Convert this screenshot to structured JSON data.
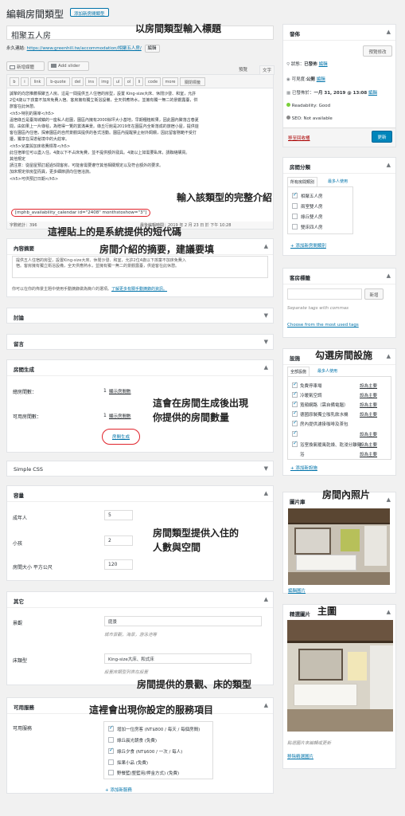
{
  "page_title": "編輯房間類型",
  "add_new_label": "添加新房間類型",
  "post_title": "相聚五人房",
  "permalink": {
    "label": "永久連結:",
    "url": "https://www.greenhill.tw/accommodation/相聚五人房/",
    "edit": "編輯"
  },
  "editor": {
    "add_media": "新增媒體",
    "add_slider": "Add slider",
    "tab_visual": "預覽",
    "tab_text": "文字",
    "quicktags": [
      "b",
      "i",
      "link",
      "b-quote",
      "del",
      "ins",
      "img",
      "ul",
      "ol",
      "li",
      "code",
      "more",
      "關閉標籤"
    ],
    "content_lines": [
      "誠摯的向您推薦相聚五人房。這是一間提供五人住宿的房型，設置 King-size大床、休閒沙發、和室，允許",
      "2位4歲以下孩童不加床免費入宿。客房擁有獨立衛浴設備，全天供應熱水，並擁有獨一無二的景觀露臺，供",
      "旅客在此休憩。",
      "<h5>特別的陽宰</h5>",
      "溫宿綠丘是臺灣城鎮的一座私人莊園，園區內擁有2000餘坪大小基地，早期種植較果，因此園內聚落古春夏",
      "間，由如果上一片綠毯，為贈得一覽的賞滿美景。綠丘行館是2019年在園區內全新落成的旅宿小屋，提供遊",
      "客在園區內住宿，探索園區的自然景觀與提供的各式活動。園區內提醒禁止射外飼餵，因此留客務範不受打",
      "擾，獨享在深遂秘境中的大莊宰。",
      "<h5>兒童與加床收費標準</h5>",
      "此住宿單位可以盡入住。4歲以下不占床免費，並不提供額外寢具。4歲以上如需要臥床，請聯絡購買。",
      "其他規定",
      "請注意：從屋屋預訂超過5間客房，可能會需要遵守其他相關規定以及符合額外的要求。",
      "加床規定依房型而異，更多細節請向住宿洽詢。",
      "<h5>可供預訂日期</h5>"
    ],
    "shortcode": "[mphb_availability_calendar id=\"2408\" monthstoshow=\"3\"]",
    "word_count": "字數統計：396",
    "last_edit": "最後編輯時間：2019 年 2 月 23 日 於 下午 10:28"
  },
  "excerpt": {
    "title": "內容摘要",
    "text_lines": [
      "提供五人住宿的房型，設置King-size大床、休閒沙發、和室，允許2位4歲以下孩童不加床免費入",
      "宿。客房擁有獨立衛浴設備，全天供應熱水，並擁有獨一無二的景觀露臺，供遊客在此休憩。"
    ],
    "help": "你可以在你的佈景主題中使用手動摘錄做為簡介的選項。",
    "help_link": "了解更多有關手動摘錄的資訊。"
  },
  "discussion_title": "討論",
  "comments_title": "留言",
  "generate_rooms": {
    "title": "房間生成",
    "total_label": "總房間數：",
    "total_value": "1",
    "total_link": "顯示房間數",
    "available_label": "可用房間數：",
    "available_value": "1",
    "available_link": "顯示房間數",
    "generate_button": "房間生成"
  },
  "simple_css_title": "Simple CSS",
  "capacity": {
    "title": "容量",
    "adults_label": "成年人",
    "adults_value": "5",
    "children_label": "小孩",
    "children_value": "2",
    "size_label": "房間大小 平方公尺",
    "size_value": "120"
  },
  "other": {
    "title": "其它",
    "view_label": "景觀",
    "view_value": "庭景",
    "view_hint": "城市景觀，海景，游泳池等",
    "bed_label": "床類型",
    "bed_value": "King-size大床、和式床",
    "bed_hint": "設置床類型列表在設置"
  },
  "services": {
    "title": "可用服務",
    "label": "可用服務",
    "items": [
      {
        "label": "增加一位房客 (NT$800 / 每天 / 每個房間)",
        "checked": true
      },
      {
        "label": "綠丘晨光朝食 (免費)",
        "checked": false
      },
      {
        "label": "綠丘夕食 (NT$600 / 一次 / 每人)",
        "checked": true
      },
      {
        "label": "採果小品 (免費)",
        "checked": false
      },
      {
        "label": "野餐籃(整籃用/押金方式) (免費)",
        "checked": false
      }
    ],
    "add_new": "+ 添加新服務"
  },
  "publish": {
    "title": "發佈",
    "preview_button": "預覽修改",
    "status_label": "狀態：",
    "status_value": "已發佈",
    "status_edit": "編輯",
    "visibility_label": "可見度:",
    "visibility_value": "公開",
    "visibility_edit": "編輯",
    "published_label": "已發佈於：",
    "published_value": "一月 31, 2019 @ 13:08",
    "published_edit": "編輯",
    "readability": "Readability: Good",
    "seo": "SEO: Not available",
    "trash": "移至回收桶",
    "update_button": "更新"
  },
  "categories": {
    "title": "房間分類",
    "tab_all": "所有房間類別",
    "tab_popular": "最多人使用",
    "items": [
      {
        "label": "相聚五人房",
        "checked": true
      },
      {
        "label": "兩室雙人房",
        "checked": false
      },
      {
        "label": "綠丘雙人房",
        "checked": false
      },
      {
        "label": "雙床四人房",
        "checked": false
      }
    ],
    "add_new": "+ 添加新房間類別"
  },
  "tags": {
    "title": "客房標籤",
    "add_button": "新增",
    "hint": "Separate tags with commas",
    "choose": "Choose from the most used tags"
  },
  "facilities": {
    "title": "設施",
    "tab_all": "全部設施",
    "tab_popular": "最多人使用",
    "items": [
      {
        "label": "免費停車場",
        "checked": true
      },
      {
        "label": "冷暖氣空調",
        "checked": true
      },
      {
        "label": "寬頻網路（需自備電腦）",
        "checked": true
      },
      {
        "label": "德國原裝獨立咖乳飲水機",
        "checked": true
      },
      {
        "label": "房內提供濾掛咖啡及茶包",
        "checked": true
      },
      {
        "label": "",
        "checked": true
      },
      {
        "label": "浴室換氣暖風乾燥、乾浸分離衛",
        "checked": true
      },
      {
        "label": "浴",
        "checked": false
      }
    ],
    "set_primary": "設為主要",
    "add_new": "+ 添加新設施"
  },
  "gallery": {
    "title": "圖片庫",
    "edit_link": "編輯圖片"
  },
  "featured": {
    "title": "精選圖片",
    "hint": "點選圖片來編輯或更新",
    "remove_link": "移除精選圖片"
  },
  "annotations": {
    "title_input": "以房間類型輸入標題",
    "full_intro": "輸入該類型的完整介紹",
    "shortcode_note": "這裡貼上的是系統提供的短代碼",
    "excerpt_note": "房間介紹的摘要，建議要填",
    "rooms_note_1": "這會在房間生成後出現",
    "rooms_note_2": "你提供的房間數量",
    "capacity_note_1": "房間類型提供入住的",
    "capacity_note_2": "人數與空間",
    "other_note": "房間提供的景觀、床的類型",
    "services_note": "這裡會出現你設定的服務項目",
    "facilities_note": "勾選房間設施",
    "gallery_note": "房間內照片",
    "featured_note": "主圖"
  },
  "colors": {
    "accent": "#0073aa",
    "highlight": "#e0232b",
    "primary_button": "#0085ba",
    "trash": "#a00"
  },
  "icons": [
    "media-icon",
    "slider-icon",
    "pin-icon",
    "eye-icon",
    "calendar-icon",
    "readability-icon",
    "seo-icon",
    "toggle-arrow-icon"
  ]
}
